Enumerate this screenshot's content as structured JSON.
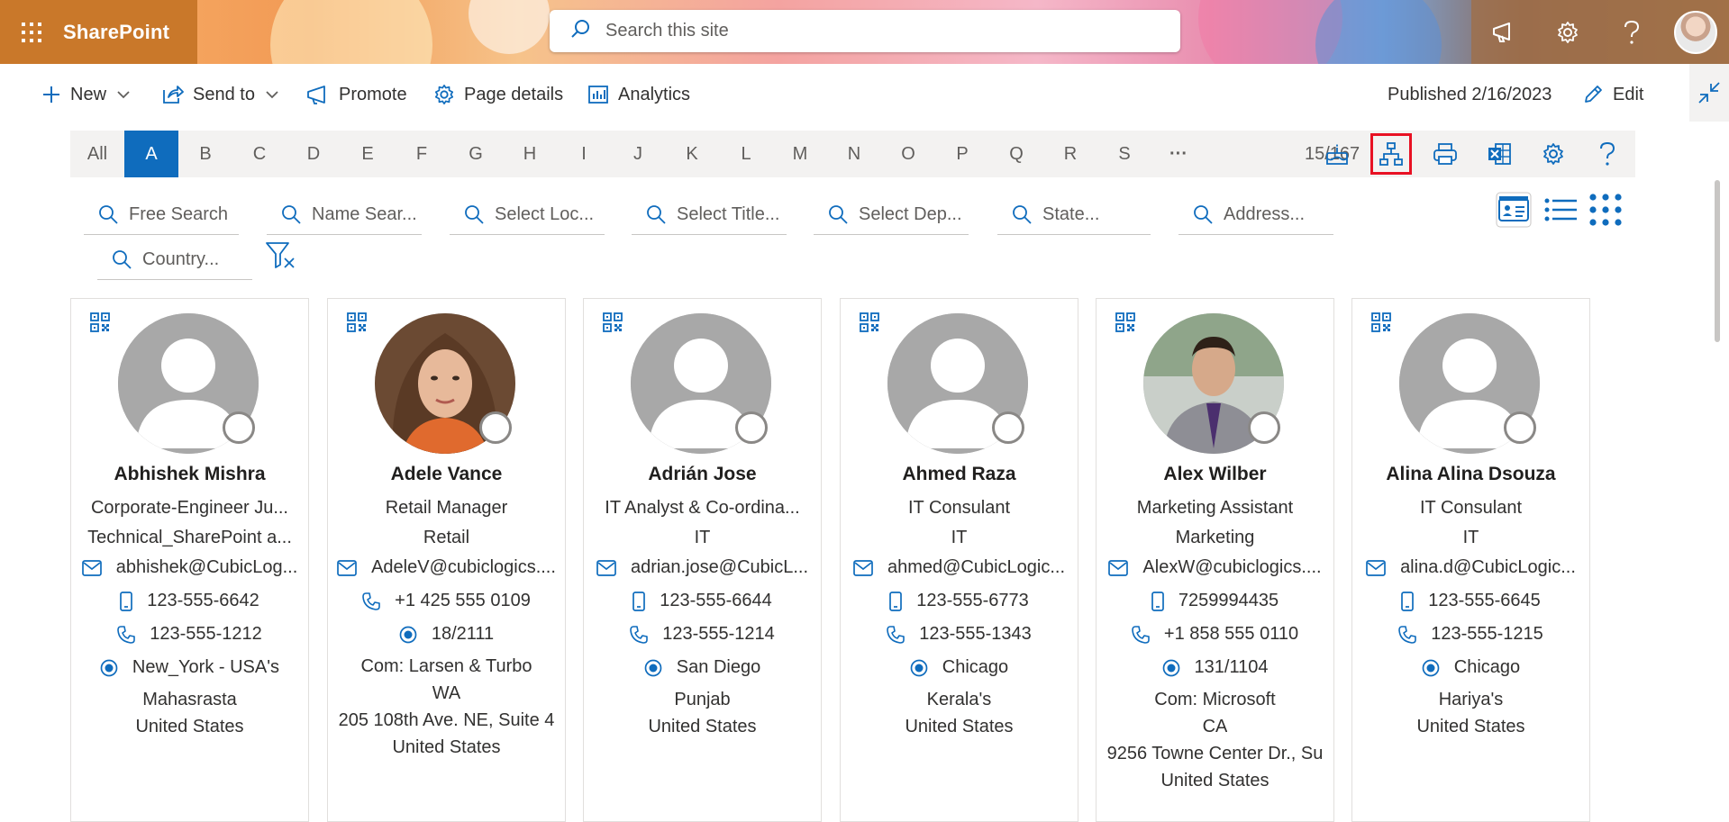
{
  "suite": {
    "app_name": "SharePoint",
    "search_placeholder": "Search this site",
    "icons": [
      "waffle-icon",
      "megaphone-icon",
      "gear-icon",
      "help-icon",
      "avatar"
    ]
  },
  "commandbar": {
    "new_label": "New",
    "send_to_label": "Send to",
    "promote_label": "Promote",
    "page_details_label": "Page details",
    "analytics_label": "Analytics",
    "published_label": "Published 2/16/2023",
    "edit_label": "Edit"
  },
  "alphabet": {
    "all_label": "All",
    "letters": [
      "A",
      "B",
      "C",
      "D",
      "E",
      "F",
      "G",
      "H",
      "I",
      "J",
      "K",
      "L",
      "M",
      "N",
      "O",
      "P",
      "Q",
      "R",
      "S"
    ],
    "active_letter": "A",
    "more_label": "···",
    "count_label": "15/167",
    "tools": [
      "birthday-cake-icon",
      "org-chart-icon",
      "print-icon",
      "excel-icon",
      "settings-icon",
      "help-icon"
    ]
  },
  "filters": {
    "free_search": "Free Search",
    "name_search": "Name Sear...",
    "location": "Select Loc...",
    "title": "Select Title...",
    "department": "Select Dep...",
    "state": "State...",
    "address": "Address...",
    "country": "Country..."
  },
  "colors": {
    "accent": "#0f6cbd",
    "highlight": "#e81123"
  },
  "cards": [
    {
      "name": "Abhishek Mishra",
      "title": "Corporate-Engineer Ju...",
      "department": "Technical_SharePoint a...",
      "email": "abhishek@CubicLog...",
      "mobile": "123-555-6642",
      "phone": "123-555-1212",
      "location": "New_York - USA's",
      "extra1": "Mahasrasta",
      "extra2": "United States",
      "extra3": "",
      "extra4": ""
    },
    {
      "name": "Adele Vance",
      "title": "Retail Manager",
      "department": "Retail",
      "email": "AdeleV@cubiclogics....",
      "mobile": "",
      "phone": "+1 425 555 0109",
      "location": "18/2111",
      "extra1": "Com: Larsen & Turbo",
      "extra2": "WA",
      "extra3": "205 108th Ave. NE, Suite 4",
      "extra4": "United States"
    },
    {
      "name": "Adrián Jose",
      "title": "IT Analyst & Co-ordina...",
      "department": "IT",
      "email": "adrian.jose@CubicL...",
      "mobile": "123-555-6644",
      "phone": "123-555-1214",
      "location": "San Diego",
      "extra1": "Punjab",
      "extra2": "United States",
      "extra3": "",
      "extra4": ""
    },
    {
      "name": "Ahmed Raza",
      "title": "IT Consulant",
      "department": "IT",
      "email": "ahmed@CubicLogic...",
      "mobile": "123-555-6773",
      "phone": "123-555-1343",
      "location": "Chicago",
      "extra1": "Kerala's",
      "extra2": "United States",
      "extra3": "",
      "extra4": ""
    },
    {
      "name": "Alex Wilber",
      "title": "Marketing Assistant",
      "department": "Marketing",
      "email": "AlexW@cubiclogics....",
      "mobile": "7259994435",
      "phone": "+1 858 555 0110",
      "location": "131/1104",
      "extra1": "Com: Microsoft",
      "extra2": "CA",
      "extra3": "9256 Towne Center Dr., Su",
      "extra4": "United States"
    },
    {
      "name": "Alina Alina Dsouza",
      "title": "IT Consulant",
      "department": "IT",
      "email": "alina.d@CubicLogic...",
      "mobile": "123-555-6645",
      "phone": "123-555-1215",
      "location": "Chicago",
      "extra1": "Hariya's",
      "extra2": "United States",
      "extra3": "",
      "extra4": ""
    }
  ]
}
